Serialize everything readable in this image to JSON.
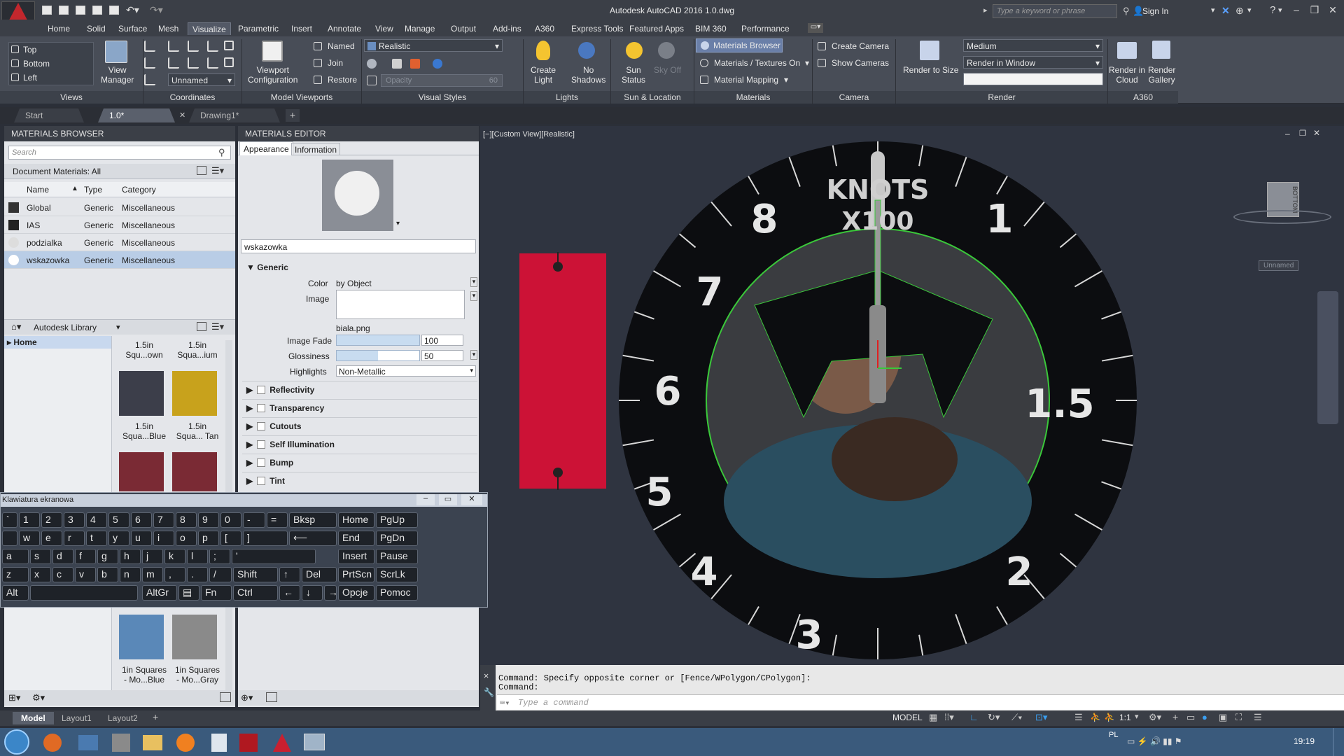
{
  "app": {
    "title": "Autodesk AutoCAD 2016   1.0.dwg",
    "search_placeholder": "Type a keyword or phrase",
    "sign_in": "Sign In"
  },
  "menu_tabs": [
    "Home",
    "Solid",
    "Surface",
    "Mesh",
    "Visualize",
    "Parametric",
    "Insert",
    "Annotate",
    "View",
    "Manage",
    "Output",
    "Add-ins",
    "A360",
    "Express Tools",
    "Featured Apps",
    "BIM 360",
    "Performance"
  ],
  "ribbon": {
    "views": {
      "items": [
        "Top",
        "Bottom",
        "Left"
      ],
      "view_manager": "View\nManager",
      "label": "Views"
    },
    "coordinates": {
      "label": "Coordinates",
      "ucs": "Unnamed"
    },
    "model_viewports": {
      "config": "Viewport\nConfiguration",
      "named": "Named",
      "join": "Join",
      "restore": "Restore",
      "label": "Model Viewports"
    },
    "visual_styles": {
      "current": "Realistic",
      "opacity": "Opacity",
      "opacity_value": "60",
      "label": "Visual Styles"
    },
    "lights": {
      "create": "Create\nLight",
      "no_shadows": "No\nShadows",
      "label": "Lights"
    },
    "sun": {
      "status": "Sun\nStatus",
      "sky": "Sky Off",
      "label": "Sun & Location"
    },
    "materials": {
      "browser": "Materials Browser",
      "textures": "Materials / Textures On",
      "mapping": "Material Mapping",
      "label": "Materials"
    },
    "camera": {
      "create": "Create Camera",
      "show": "Show  Cameras",
      "label": "Camera"
    },
    "render": {
      "size": "Render to Size",
      "quality": "Medium",
      "dest": "Render in Window",
      "label": "Render"
    },
    "a360": {
      "cloud": "Render in\nCloud",
      "gallery": "Render\nGallery",
      "label": "A360"
    }
  },
  "file_tabs": [
    "Start",
    "1.0*",
    "Drawing1*"
  ],
  "materials_browser": {
    "title": "MATERIALS BROWSER",
    "search": "Search",
    "filter": "Document Materials: All",
    "columns": [
      "Name",
      "Type",
      "Category"
    ],
    "rows": [
      {
        "name": "Global",
        "type": "Generic",
        "category": "Miscellaneous"
      },
      {
        "name": "IAS",
        "type": "Generic",
        "category": "Miscellaneous"
      },
      {
        "name": "podzialka",
        "type": "Generic",
        "category": "Miscellaneous"
      },
      {
        "name": "wskazowka",
        "type": "Generic",
        "category": "Miscellaneous"
      }
    ],
    "library": "Autodesk Library",
    "tree_home": "Home",
    "thumbs": [
      {
        "label": "1.5in\nSqu...own"
      },
      {
        "label": "1.5in\nSqua...ium"
      },
      {
        "label": "1.5in\nSqua...Blue"
      },
      {
        "label": "1.5in\nSqua... Tan"
      },
      {
        "label": "1in Squares\n- Mo...Blue"
      },
      {
        "label": "1in Squares\n- Mo...Gray"
      }
    ]
  },
  "materials_editor": {
    "title": "MATERIALS EDITOR",
    "tabs": [
      "Appearance",
      "Information"
    ],
    "name": "wskazowka",
    "generic": "Generic",
    "color_label": "Color",
    "color_value": "by Object",
    "image_label": "Image",
    "image_file": "biala.png",
    "fade_label": "Image Fade",
    "fade_value": "100",
    "gloss_label": "Glossiness",
    "gloss_value": "50",
    "highlights_label": "Highlights",
    "highlights_value": "Non-Metallic",
    "sections": [
      "Reflectivity",
      "Transparency",
      "Cutouts",
      "Self Illumination",
      "Bump",
      "Tint"
    ]
  },
  "viewport": {
    "label": "[−][Custom View][Realistic]",
    "cube_face": "BOTTOM",
    "ucs_name": "Unnamed",
    "dial": {
      "title": "KNOTS",
      "subtitle": "X100",
      "numbers": [
        "8",
        "1",
        "7",
        "6",
        "1.5",
        "5",
        "4",
        "2",
        "3"
      ]
    }
  },
  "command": {
    "line1": "Command: Specify opposite corner or [Fence/WPolygon/CPolygon]:",
    "line2": "Command:",
    "placeholder": "Type a command"
  },
  "layouts": [
    "Model",
    "Layout1",
    "Layout2"
  ],
  "status": {
    "model": "MODEL",
    "scale": "1:1",
    "lang": "PL",
    "time": "19:19"
  },
  "osk": {
    "title": "Klawiatura ekranowa"
  }
}
